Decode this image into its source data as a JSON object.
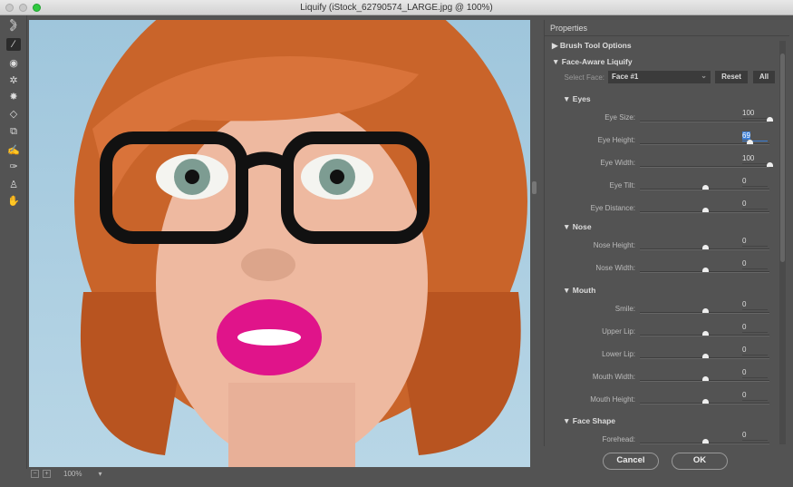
{
  "window": {
    "title": "Liquify (iStock_62790574_LARGE.jpg @ 100%)"
  },
  "status": {
    "zoom": "100%"
  },
  "panel": {
    "title": "Properties",
    "brush_section": "Brush Tool Options",
    "face_section": "Face-Aware Liquify",
    "select_face_label": "Select Face:",
    "select_face_value": "Face #1",
    "reset": "Reset",
    "all": "All",
    "groups": [
      {
        "title": "Eyes",
        "sliders": [
          {
            "label": "Eye Size:",
            "value": "100",
            "pos": 1.0
          },
          {
            "label": "Eye Height:",
            "value": "69",
            "pos": 0.845,
            "selected": true
          },
          {
            "label": "Eye Width:",
            "value": "100",
            "pos": 1.0
          },
          {
            "label": "Eye Tilt:",
            "value": "0",
            "pos": 0.5
          },
          {
            "label": "Eye Distance:",
            "value": "0",
            "pos": 0.5
          }
        ]
      },
      {
        "title": "Nose",
        "sliders": [
          {
            "label": "Nose Height:",
            "value": "0",
            "pos": 0.5
          },
          {
            "label": "Nose Width:",
            "value": "0",
            "pos": 0.5
          }
        ]
      },
      {
        "title": "Mouth",
        "sliders": [
          {
            "label": "Smile:",
            "value": "0",
            "pos": 0.5
          },
          {
            "label": "Upper Lip:",
            "value": "0",
            "pos": 0.5
          },
          {
            "label": "Lower Lip:",
            "value": "0",
            "pos": 0.5
          },
          {
            "label": "Mouth Width:",
            "value": "0",
            "pos": 0.5
          },
          {
            "label": "Mouth Height:",
            "value": "0",
            "pos": 0.5
          }
        ]
      },
      {
        "title": "Face Shape",
        "sliders": [
          {
            "label": "Forehead:",
            "value": "0",
            "pos": 0.5
          }
        ]
      }
    ]
  },
  "buttons": {
    "cancel": "Cancel",
    "ok": "OK"
  },
  "tools": [
    "forward-warp",
    "reconstruct",
    "smooth",
    "twirl",
    "pucker",
    "bloat",
    "push-left",
    "freeze-mask",
    "thaw-mask",
    "face",
    "hand",
    "zoom"
  ]
}
